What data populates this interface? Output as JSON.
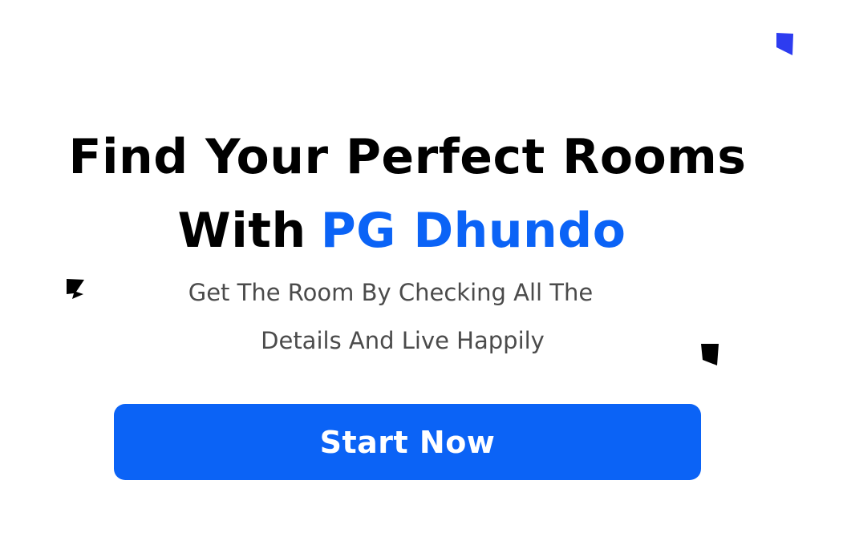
{
  "hero": {
    "headline_line1": "Find Your Perfect Rooms",
    "headline_with": "With",
    "brand_name": "PG Dhundo",
    "subtitle_line1": "Get The Room By Checking All The",
    "subtitle_line2": "Details And Live Happily",
    "cta_label": "Start Now"
  },
  "colors": {
    "accent": "#0b63f6",
    "headline": "#000000",
    "subtitle": "#4b4b4b",
    "background": "#ffffff"
  }
}
